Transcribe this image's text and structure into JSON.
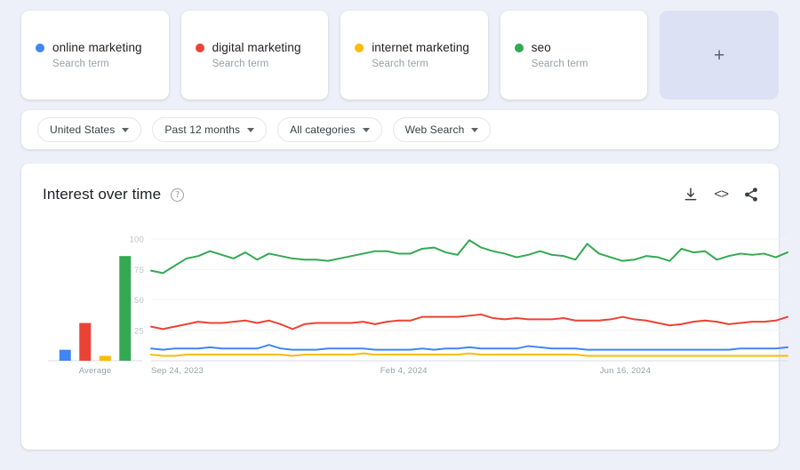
{
  "terms": [
    {
      "label": "online marketing",
      "sub": "Search term",
      "color": "#4285F4"
    },
    {
      "label": "digital marketing",
      "sub": "Search term",
      "color": "#EA4335"
    },
    {
      "label": "internet marketing",
      "sub": "Search term",
      "color": "#FBBC04"
    },
    {
      "label": "seo",
      "sub": "Search term",
      "color": "#34A853"
    }
  ],
  "add_card": {
    "glyph": "+",
    "icon": "plus-icon"
  },
  "filters": [
    {
      "label": "United States"
    },
    {
      "label": "Past 12 months"
    },
    {
      "label": "All categories"
    },
    {
      "label": "Web Search"
    }
  ],
  "chart_card": {
    "title": "Interest over time",
    "help_glyph": "?",
    "actions": [
      {
        "name": "download-icon",
        "label": "Download"
      },
      {
        "name": "embed-icon",
        "label": "<>"
      },
      {
        "name": "share-icon",
        "label": "Share"
      }
    ]
  },
  "chart_data": {
    "type": "line",
    "title": "Interest over time",
    "xlabel": "",
    "ylabel": "",
    "ylim": [
      0,
      100
    ],
    "grid": true,
    "legend_position": "top-cards",
    "yticks": [
      100,
      75,
      50,
      25
    ],
    "xticks": [
      "Sep 24, 2023",
      "Feb 4, 2024",
      "Jun 16, 2024"
    ],
    "x_start": "Sep 24, 2023",
    "x_end": "Sep 8, 2024",
    "average_panel": {
      "label": "Average",
      "type": "bar",
      "categories": [
        "online marketing",
        "digital marketing",
        "internet marketing",
        "seo"
      ],
      "values": [
        9,
        31,
        4,
        86
      ],
      "colors": [
        "#4285F4",
        "#EA4335",
        "#FBBC04",
        "#34A853"
      ]
    },
    "series": [
      {
        "name": "online marketing",
        "color": "#4285F4",
        "values": [
          10,
          9,
          10,
          10,
          10,
          11,
          10,
          10,
          10,
          10,
          13,
          10,
          9,
          9,
          9,
          10,
          10,
          10,
          10,
          9,
          9,
          9,
          9,
          10,
          9,
          10,
          10,
          11,
          10,
          10,
          10,
          10,
          12,
          11,
          10,
          10,
          10,
          9,
          9,
          9,
          9,
          9,
          9,
          9,
          9,
          9,
          9,
          9,
          9,
          9,
          10,
          10,
          10,
          10,
          11
        ]
      },
      {
        "name": "digital marketing",
        "color": "#EA4335",
        "values": [
          28,
          26,
          28,
          30,
          32,
          31,
          31,
          32,
          33,
          31,
          33,
          30,
          26,
          30,
          31,
          31,
          31,
          31,
          32,
          30,
          32,
          33,
          33,
          36,
          36,
          36,
          36,
          37,
          38,
          35,
          34,
          35,
          34,
          34,
          34,
          35,
          33,
          33,
          33,
          34,
          36,
          34,
          33,
          31,
          29,
          30,
          32,
          33,
          32,
          30,
          31,
          32,
          32,
          33,
          36
        ]
      },
      {
        "name": "internet marketing",
        "color": "#FBBC04",
        "values": [
          5,
          4,
          4,
          5,
          5,
          5,
          5,
          5,
          5,
          5,
          5,
          5,
          4,
          5,
          5,
          5,
          5,
          5,
          6,
          5,
          5,
          5,
          5,
          5,
          5,
          5,
          5,
          6,
          5,
          5,
          5,
          5,
          5,
          5,
          5,
          5,
          5,
          4,
          4,
          4,
          4,
          4,
          4,
          4,
          4,
          4,
          4,
          4,
          4,
          4,
          4,
          4,
          4,
          4,
          4
        ]
      },
      {
        "name": "seo",
        "color": "#34A853",
        "values": [
          74,
          72,
          78,
          84,
          86,
          90,
          87,
          84,
          89,
          83,
          88,
          86,
          84,
          83,
          83,
          82,
          84,
          86,
          88,
          90,
          90,
          88,
          88,
          92,
          93,
          89,
          87,
          99,
          93,
          90,
          88,
          85,
          87,
          90,
          87,
          86,
          83,
          96,
          88,
          85,
          82,
          83,
          86,
          85,
          82,
          92,
          89,
          90,
          83,
          86,
          88,
          87,
          88,
          85,
          89
        ]
      }
    ]
  }
}
